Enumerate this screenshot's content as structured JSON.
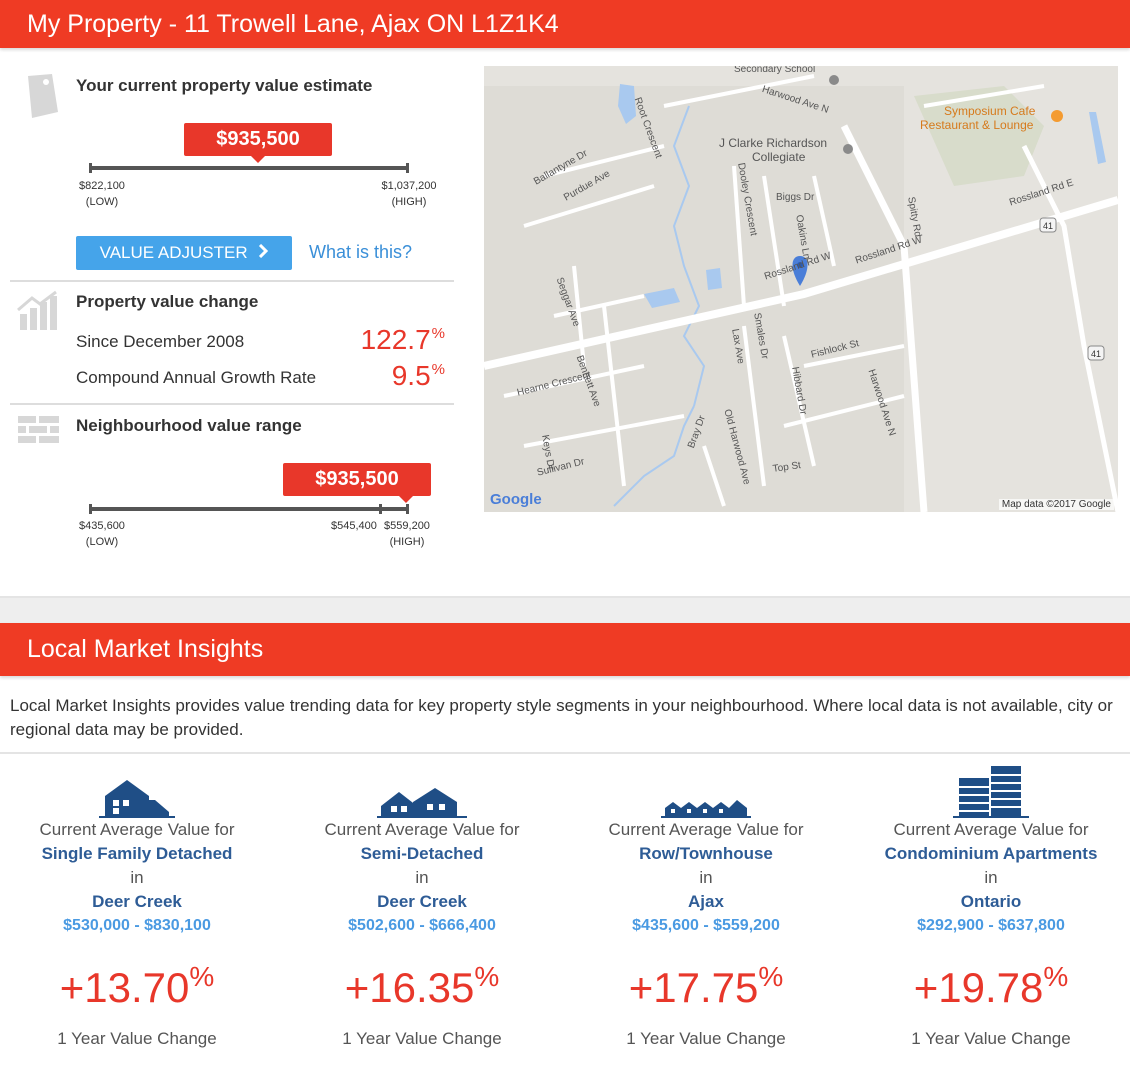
{
  "header": {
    "title": "My Property - 11 Trowell Lane, Ajax ON L1Z1K4"
  },
  "estimate": {
    "heading": "Your current property value estimate",
    "value": "$935,500",
    "low": "$822,100",
    "high": "$1,037,200",
    "low_tag": "(LOW)",
    "high_tag": "(HIGH)",
    "position_fraction": 0.53
  },
  "adjuster": {
    "button_label": "VALUE ADJUSTER",
    "help_link": "What is this?"
  },
  "change": {
    "heading": "Property value change",
    "since_label": "Since December 2008",
    "since_value": "122.7",
    "cagr_label": "Compound Annual Growth Rate",
    "cagr_value": "9.5",
    "unit": "%"
  },
  "neighbourhood": {
    "heading": "Neighbourhood value range",
    "value": "$935,500",
    "low": "$435,600",
    "mid": "$545,400",
    "high": "$559,200",
    "low_tag": "(LOW)",
    "high_tag": "(HIGH)"
  },
  "map": {
    "attribution": "Map data ©2017 Google",
    "brand": "Google",
    "labels": [
      "Secondary School",
      "Harwood Ave N",
      "J Clarke Richardson",
      "Collegiate",
      "Symposium Cafe",
      "Restaurant & Lounge",
      "Root Crescent",
      "Ballantyne Dr",
      "Purdue Ave",
      "Dooley Crescent",
      "Biggs Dr",
      "Oakins Ln",
      "Rossland Rd E",
      "Rossland Rd W",
      "Rossland Rd W",
      "Seggar Ave",
      "Bennett Ave",
      "Lax Ave",
      "Smales Dr",
      "Fishlock St",
      "Hibbard Dr",
      "Hearne Crescent",
      "Keys Dr",
      "Sullivan Dr",
      "Bray Dr",
      "Old Harwood Ave",
      "Top St",
      "Spitty Rd",
      "Harwood Ave N",
      "41",
      "41"
    ]
  },
  "insights": {
    "title": "Local Market Insights",
    "intro": "Local Market Insights provides value trending data for key property style segments in your neighbourhood. Where local data is not available, city or regional data may be provided.",
    "cards": [
      {
        "icon": "detached-house-icon",
        "line": "Current Average Value for",
        "type": "Single Family Detached",
        "in": "in",
        "area": "Deer Creek",
        "range": "$530,000 - $830,100",
        "pct": "+13.70",
        "unit": "%",
        "foot": "1 Year Value Change"
      },
      {
        "icon": "semi-detached-icon",
        "line": "Current Average Value for",
        "type": "Semi-Detached",
        "in": "in",
        "area": "Deer Creek",
        "range": "$502,600 - $666,400",
        "pct": "+16.35",
        "unit": "%",
        "foot": "1 Year Value Change"
      },
      {
        "icon": "townhouse-icon",
        "line": "Current Average Value for",
        "type": "Row/Townhouse",
        "in": "in",
        "area": "Ajax",
        "range": "$435,600 - $559,200",
        "pct": "+17.75",
        "unit": "%",
        "foot": "1 Year Value Change"
      },
      {
        "icon": "condo-building-icon",
        "line": "Current Average Value for",
        "type": "Condominium Apartments",
        "in": "in",
        "area": "Ontario",
        "range": "$292,900 - $637,800",
        "pct": "+19.78",
        "unit": "%",
        "foot": "1 Year Value Change"
      }
    ]
  },
  "colors": {
    "brand_red": "#ef3b24",
    "button_blue": "#45a4ea",
    "link_blue": "#3a8fd8",
    "navy": "#1f4e86"
  }
}
